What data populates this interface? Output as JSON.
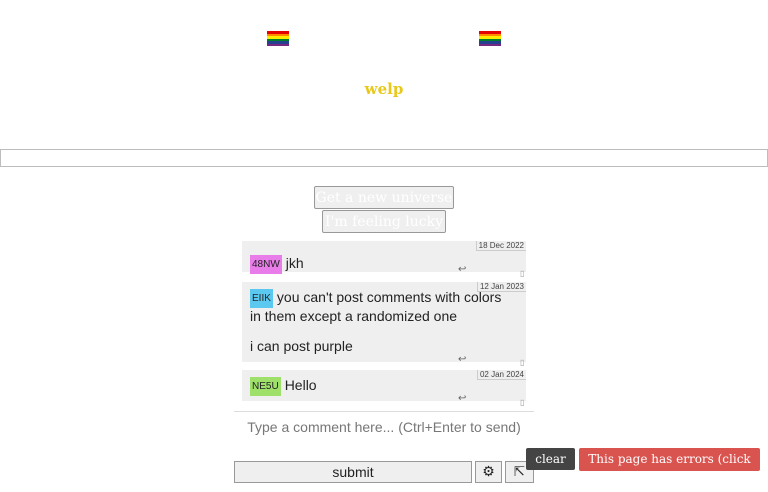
{
  "header": {
    "title": "welp",
    "flag_colors": [
      "#e40303",
      "#ff8c00",
      "#ffed00",
      "#008026",
      "#24408e",
      "#732982"
    ]
  },
  "url_bar": {
    "value": ""
  },
  "buttons": {
    "new_universe": "Get a new universe",
    "feeling_lucky": "I'm feeling lucky"
  },
  "comments": [
    {
      "tag": "48NW",
      "tag_color": "#e87ce8",
      "date": "18 Dec 2022",
      "lines": [
        "jkh"
      ]
    },
    {
      "tag": "EIIK",
      "tag_color": "#5bc8f0",
      "date": "12 Jan 2023",
      "lines": [
        "you can't post comments with colors in them except a randomized one",
        "",
        "i can post purple"
      ]
    },
    {
      "tag": "NE5U",
      "tag_color": "#9ee06a",
      "date": "02 Jan 2024",
      "lines": [
        "Hello"
      ]
    }
  ],
  "comment_box": {
    "placeholder": "Type a comment here... (Ctrl+Enter to send)"
  },
  "actions": {
    "submit": "submit",
    "settings_icon": "⚙",
    "expand_icon": "⇱"
  },
  "overlays": {
    "clear": " clear",
    "errors": "This page has errors (click here)"
  }
}
